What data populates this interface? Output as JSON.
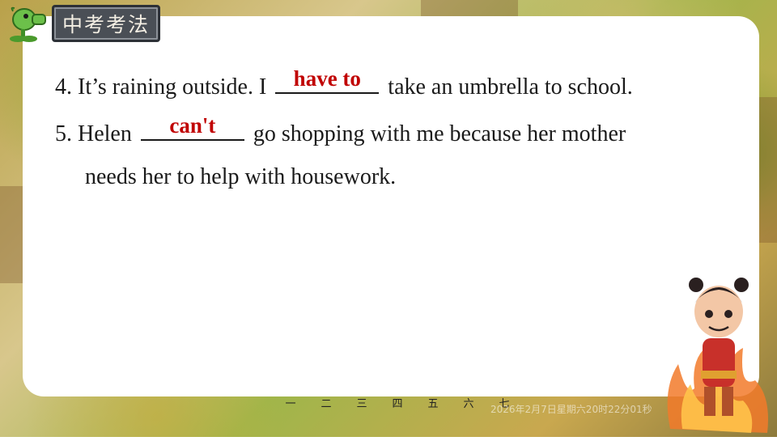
{
  "badge": {
    "title": "中考考法",
    "icon": "peashooter-icon"
  },
  "exercises": [
    {
      "before": "4. It’s raining outside. I ",
      "answer": "have to",
      "after": " take an umbrella to school."
    },
    {
      "before": "5. Helen ",
      "answer": "can't",
      "after": " go shopping with me because her mother",
      "continuation": "needs her to help with housework."
    }
  ],
  "nav": {
    "items": [
      "一",
      "二",
      "三",
      "四",
      "五",
      "六",
      "七"
    ]
  },
  "footer": {
    "date": "2026年2月7日星期六20时22分01秒"
  },
  "colors": {
    "answer": "#c00000",
    "text": "#1a1a1a",
    "card": "#ffffff",
    "badge_bg": "#4a4f56"
  },
  "decor": {
    "character": "cartoon-boy-character"
  }
}
